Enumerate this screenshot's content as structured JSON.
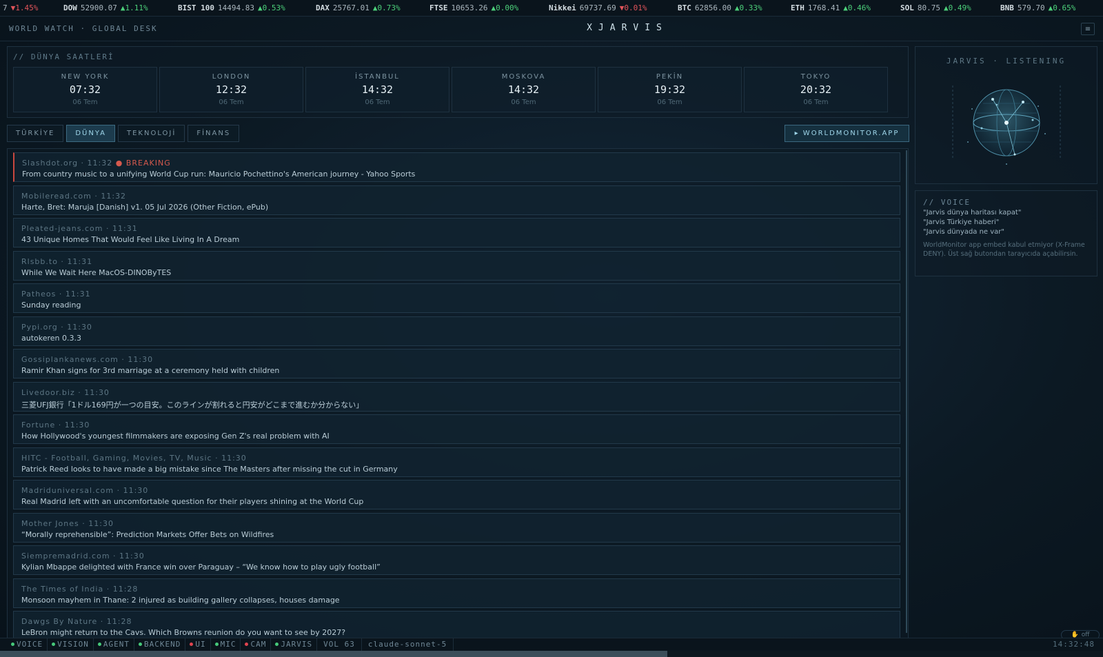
{
  "ticker": [
    {
      "sym": "",
      "val": "7",
      "chg": "▼1.45%",
      "dir": "down"
    },
    {
      "sym": "DOW",
      "val": "52900.07",
      "chg": "▲1.11%",
      "dir": "up"
    },
    {
      "sym": "BIST 100",
      "val": "14494.83",
      "chg": "▲0.53%",
      "dir": "up"
    },
    {
      "sym": "DAX",
      "val": "25767.01",
      "chg": "▲0.73%",
      "dir": "up"
    },
    {
      "sym": "FTSE",
      "val": "10653.26",
      "chg": "▲0.00%",
      "dir": "up"
    },
    {
      "sym": "Nikkei",
      "val": "69737.69",
      "chg": "▼0.01%",
      "dir": "down"
    },
    {
      "sym": "BTC",
      "val": "62856.00",
      "chg": "▲0.33%",
      "dir": "up"
    },
    {
      "sym": "ETH",
      "val": "1768.41",
      "chg": "▲0.46%",
      "dir": "up"
    },
    {
      "sym": "SOL",
      "val": "80.75",
      "chg": "▲0.49%",
      "dir": "up"
    },
    {
      "sym": "BNB",
      "val": "579.70",
      "chg": "▲0.65%",
      "dir": "up"
    }
  ],
  "header": {
    "left": "WORLD WATCH · GLOBAL DESK",
    "center": "XJARVIS",
    "menu_icon": "≡"
  },
  "clocks": {
    "title": "// DÜNYA SAATLERİ",
    "items": [
      {
        "city": "NEW YORK",
        "time": "07:32",
        "date": "06 Tem"
      },
      {
        "city": "LONDON",
        "time": "12:32",
        "date": "06 Tem"
      },
      {
        "city": "İSTANBUL",
        "time": "14:32",
        "date": "06 Tem"
      },
      {
        "city": "MOSKOVA",
        "time": "14:32",
        "date": "06 Tem"
      },
      {
        "city": "PEKİN",
        "time": "19:32",
        "date": "06 Tem"
      },
      {
        "city": "TOKYO",
        "time": "20:32",
        "date": "06 Tem"
      }
    ]
  },
  "tabs": [
    {
      "label": "TÜRKİYE",
      "active": false
    },
    {
      "label": "DÜNYA",
      "active": true
    },
    {
      "label": "TEKNOLOJİ",
      "active": false
    },
    {
      "label": "FİNANS",
      "active": false
    }
  ],
  "worldmonitor_button": "▸ WORLDMONITOR.APP",
  "news": [
    {
      "source": "Slashdot.org",
      "time": "11:32",
      "breaking": "● BREAKING",
      "headline": "From country music to a unifying World Cup run: Mauricio Pochettino's American journey - Yahoo Sports"
    },
    {
      "source": "Mobileread.com",
      "time": "11:32",
      "headline": "Harte, Bret: Maruja [Danish] v1. 05 Jul 2026 (Other Fiction, ePub)"
    },
    {
      "source": "Pleated-jeans.com",
      "time": "11:31",
      "headline": "43 Unique Homes That Would Feel Like Living In A Dream"
    },
    {
      "source": "Rlsbb.to",
      "time": "11:31",
      "headline": "While We Wait Here MacOS-DINOByTES"
    },
    {
      "source": "Patheos",
      "time": "11:31",
      "headline": "Sunday reading"
    },
    {
      "source": "Pypi.org",
      "time": "11:30",
      "headline": "autokeren 0.3.3"
    },
    {
      "source": "Gossiplankanews.com",
      "time": "11:30",
      "headline": "Ramir Khan signs for 3rd marriage at a ceremony held with children"
    },
    {
      "source": "Livedoor.biz",
      "time": "11:30",
      "headline": "三菱UFJ銀行「1ドル169円が一つの目安。このラインが割れると円安がどこまで進むか分からない」"
    },
    {
      "source": "Fortune",
      "time": "11:30",
      "headline": "How Hollywood's youngest filmmakers are exposing Gen Z's real problem with AI"
    },
    {
      "source": "HITC - Football, Gaming, Movies, TV, Music",
      "time": "11:30",
      "headline": "Patrick Reed looks to have made a big mistake since The Masters after missing the cut in Germany"
    },
    {
      "source": "Madriduniversal.com",
      "time": "11:30",
      "headline": "Real Madrid left with an uncomfortable question for their players shining at the World Cup"
    },
    {
      "source": "Mother Jones",
      "time": "11:30",
      "headline": "“Morally reprehensible”: Prediction Markets Offer Bets on Wildfires"
    },
    {
      "source": "Siempremadrid.com",
      "time": "11:30",
      "headline": "Kylian Mbappe delighted with France win over Paraguay – “We know how to play ugly football”"
    },
    {
      "source": "The Times of India",
      "time": "11:28",
      "headline": "Monsoon mayhem in Thane: 2 injured as building gallery collapses, houses damage"
    },
    {
      "source": "Dawgs By Nature",
      "time": "11:28",
      "headline": "LeBron might return to the Cavs. Which Browns reunion do you want to see by 2027?"
    }
  ],
  "jarvis": {
    "title": "JARVIS · LISTENING"
  },
  "voice": {
    "title": "// VOICE",
    "commands": [
      "\"Jarvis dünya haritası kapat\"",
      "\"Jarvis Türkiye haberi\"",
      "\"Jarvis dünyada ne var\""
    ],
    "note": "WorldMonitor app embed kabul etmiyor (X-Frame DENY). Üst sağ butondan tarayıcıda açabilirsin."
  },
  "mini_toggle": {
    "icon": "✋",
    "label": "off"
  },
  "status": {
    "items": [
      {
        "label": "VOICE",
        "state": "ok"
      },
      {
        "label": "VISION",
        "state": "ok"
      },
      {
        "label": "AGENT",
        "state": "ok"
      },
      {
        "label": "BACKEND",
        "state": "ok"
      },
      {
        "label": "UI",
        "state": "err"
      },
      {
        "label": "MIC",
        "state": "ok"
      },
      {
        "label": "CAM",
        "state": "err"
      },
      {
        "label": "JARVIS",
        "state": "ok"
      }
    ],
    "volume": "VOL 63",
    "model": "claude-sonnet-5",
    "clock": "14:32:48",
    "progress": 0.605
  },
  "colors": {
    "ok": "#46c97a",
    "err": "#e0444f",
    "accent": "#9fd6ea",
    "breaking": "#d5594d"
  }
}
